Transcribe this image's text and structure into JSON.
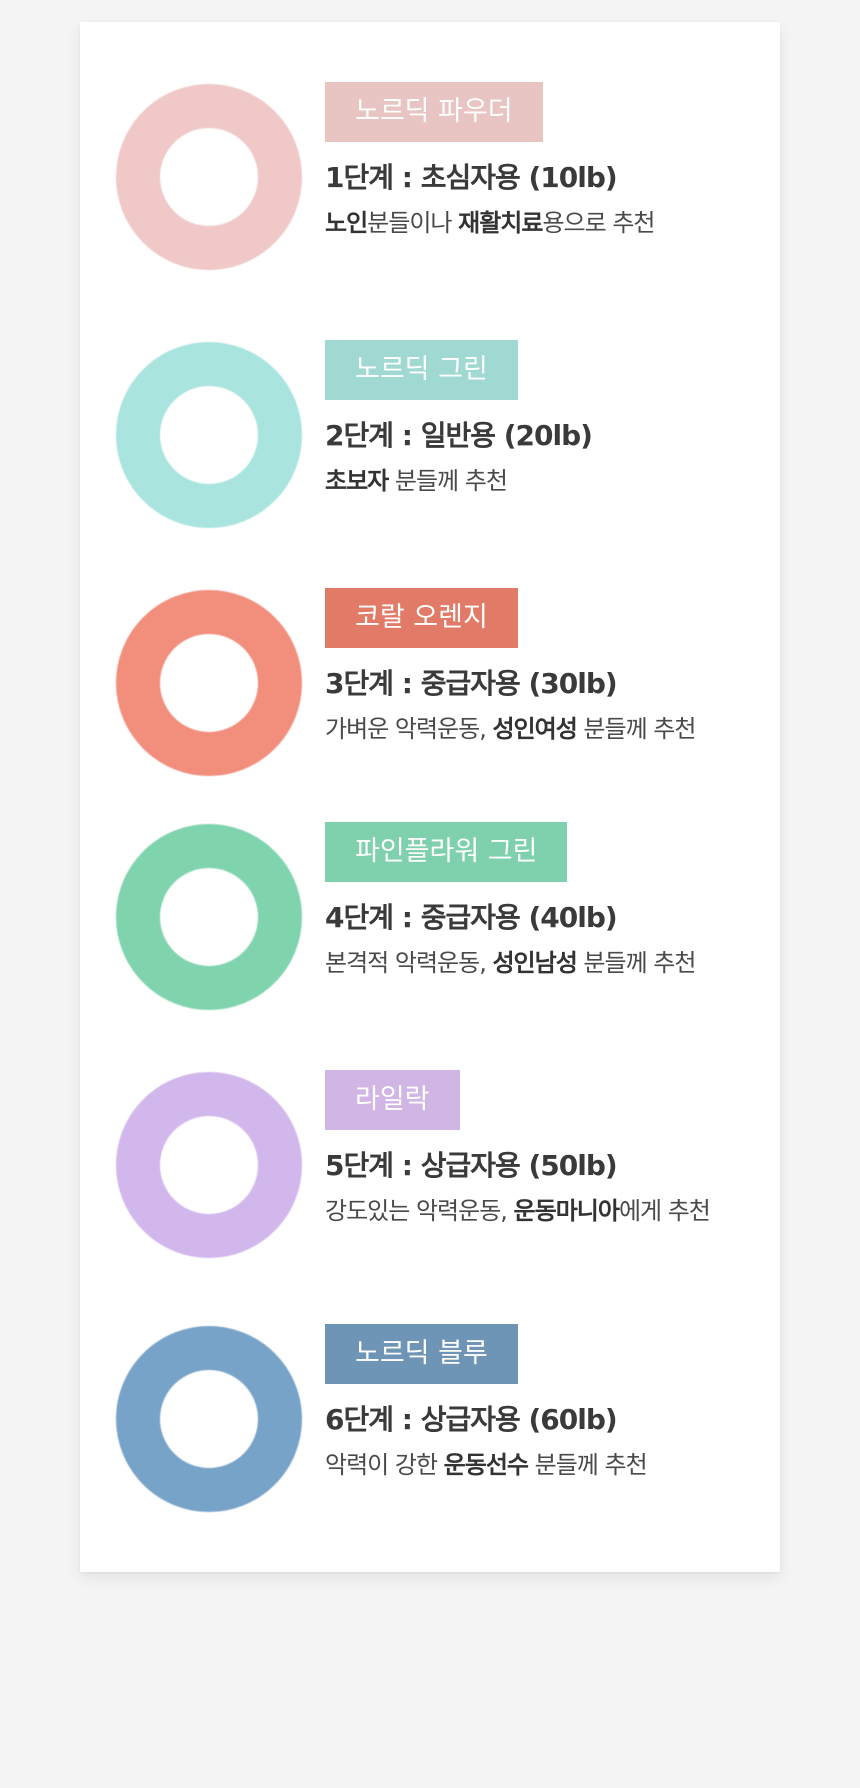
{
  "items": [
    {
      "badge": "노르딕 파우더",
      "badge_color": "#e8c4c3",
      "ring_color": "#efc8c7",
      "level": "1단계 : 초심자용 (10lb)",
      "desc": [
        {
          "text": "노인",
          "bold": true
        },
        {
          "text": "분들이나 ",
          "bold": false
        },
        {
          "text": "재활치료",
          "bold": true
        },
        {
          "text": "용으로 추천",
          "bold": false
        }
      ]
    },
    {
      "badge": "노르딕 그린",
      "badge_color": "#9fd9d2",
      "ring_color": "#a9e4de",
      "level": "2단계 : 일반용 (20lb)",
      "desc": [
        {
          "text": "초보자",
          "bold": true
        },
        {
          "text": " 분들께 추천",
          "bold": false
        }
      ]
    },
    {
      "badge": "코랄 오렌지",
      "badge_color": "#e27a68",
      "ring_color": "#f28e7c",
      "level": "3단계 : 중급자용 (30lb)",
      "desc": [
        {
          "text": "가벼운 악력운동, ",
          "bold": false
        },
        {
          "text": "성인여성",
          "bold": true
        },
        {
          "text": " 분들께 추천",
          "bold": false
        }
      ]
    },
    {
      "badge": "파인플라워 그린",
      "badge_color": "#7fd0ad",
      "ring_color": "#7fd4ae",
      "level": "4단계 : 중급자용 (40lb)",
      "desc": [
        {
          "text": "본격적 악력운동, ",
          "bold": false
        },
        {
          "text": "성인남성",
          "bold": true
        },
        {
          "text": " 분들께 추천",
          "bold": false
        }
      ]
    },
    {
      "badge": "라일락",
      "badge_color": "#d1b5e4",
      "ring_color": "#d2b7ec",
      "level": "5단계 : 상급자용 (50lb)",
      "desc": [
        {
          "text": "강도있는 악력운동, ",
          "bold": false
        },
        {
          "text": "운동마니아",
          "bold": true
        },
        {
          "text": "에게 추천",
          "bold": false
        }
      ]
    },
    {
      "badge": "노르딕 블루",
      "badge_color": "#6f95b6",
      "ring_color": "#78a3c9",
      "level": "6단계 : 상급자용 (60lb)",
      "desc": [
        {
          "text": "악력이 강한 ",
          "bold": false
        },
        {
          "text": "운동선수",
          "bold": true
        },
        {
          "text": " 분들께 추천",
          "bold": false
        }
      ]
    }
  ]
}
